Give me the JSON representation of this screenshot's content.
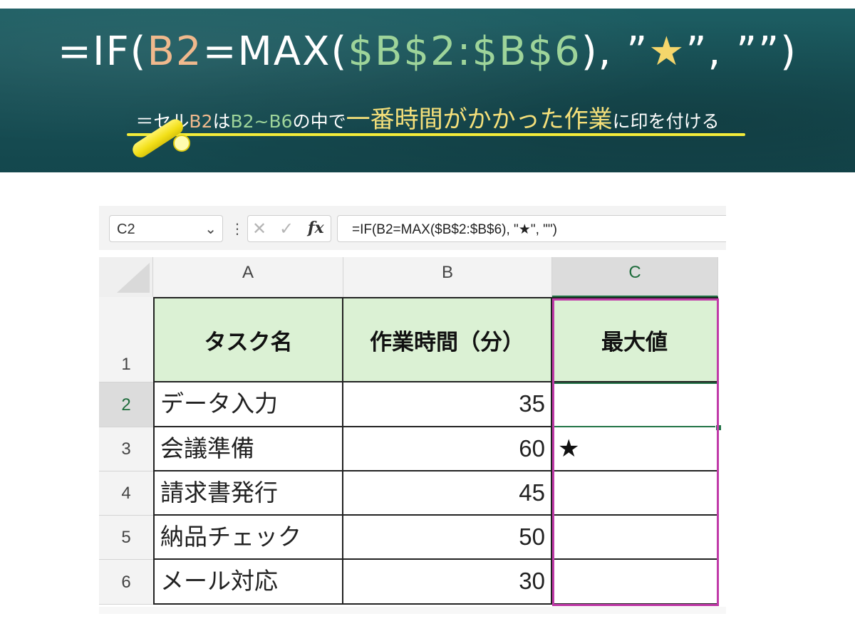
{
  "banner": {
    "formula": {
      "part1": "=IF(",
      "ref1": "B2",
      "part2": "=MAX(",
      "ref2": "$B$2:$B$6",
      "part3": "), ”",
      "star": "★",
      "part4": "”, ””)"
    },
    "desc": {
      "p1": "＝セル",
      "ref1": "B2",
      "p2": "は",
      "ref2": "B2~B6",
      "p3": "の中で",
      "emph": "一番時間がかかった作業",
      "p4": "に印を付ける"
    }
  },
  "formula_bar": {
    "name_box": "C2",
    "fx_label": "fx",
    "formula": "=IF(B2=MAX($B$2:$B$6), \"★\", \"\")"
  },
  "columns": [
    "A",
    "B",
    "C"
  ],
  "rows": [
    "1",
    "2",
    "3",
    "4",
    "5",
    "6"
  ],
  "table": {
    "headers": [
      "タスク名",
      "作業時間（分）",
      "最大値"
    ],
    "rows": [
      {
        "task": "データ入力",
        "minutes": "35",
        "max": ""
      },
      {
        "task": "会議準備",
        "minutes": "60",
        "max": "★"
      },
      {
        "task": "請求書発行",
        "minutes": "45",
        "max": ""
      },
      {
        "task": "納品チェック",
        "minutes": "50",
        "max": ""
      },
      {
        "task": "メール対応",
        "minutes": "30",
        "max": ""
      }
    ]
  },
  "colors": {
    "header_fill": "#dbf1d4",
    "highlight_border": "#c03aa8",
    "excel_green": "#217346",
    "chalkboard": "#1d5f64"
  }
}
